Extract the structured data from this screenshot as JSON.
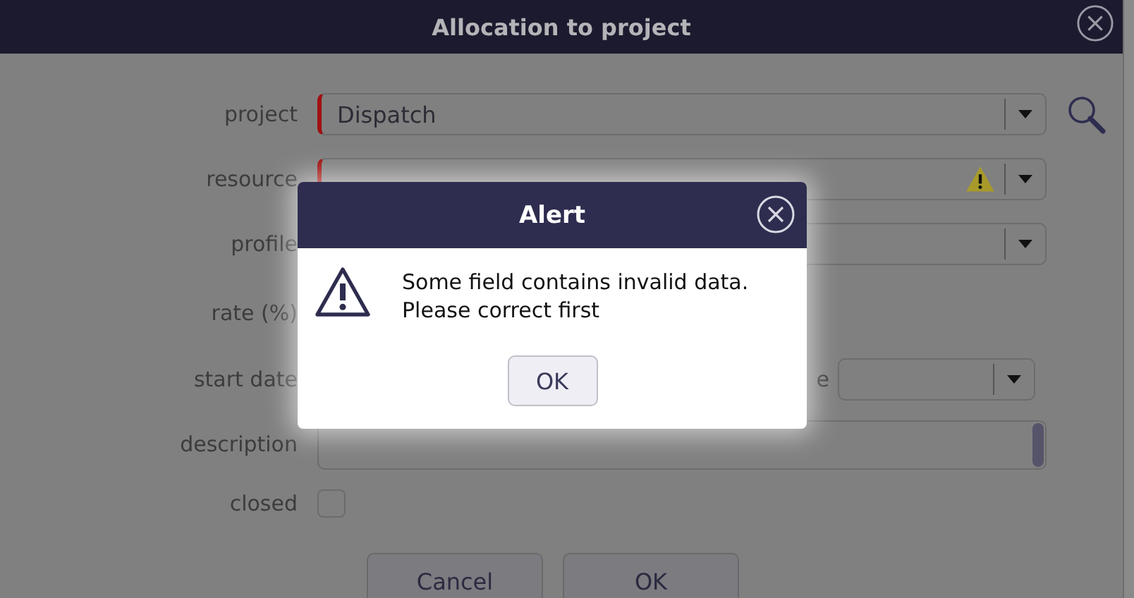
{
  "dialog": {
    "title": "Allocation to project",
    "fields": [
      {
        "kind": "select",
        "label": "project",
        "value": "Dispatch",
        "required": true,
        "warning": false,
        "search": true
      },
      {
        "kind": "select",
        "label": "resource",
        "required": true,
        "warning": true,
        "search": false
      },
      {
        "kind": "select",
        "label": "profile",
        "warning": false,
        "search": false
      },
      {
        "kind": "label",
        "label": "rate (%)"
      },
      {
        "kind": "pair",
        "label": "start date",
        "second_label": "e"
      },
      {
        "kind": "textarea",
        "label": "description"
      },
      {
        "kind": "checkbox",
        "label": "closed",
        "checked": false
      }
    ],
    "buttons": [
      "Cancel",
      "OK"
    ]
  },
  "alert": {
    "title": "Alert",
    "message": "Some field contains invalid data.\nPlease correct first",
    "button": "OK"
  }
}
